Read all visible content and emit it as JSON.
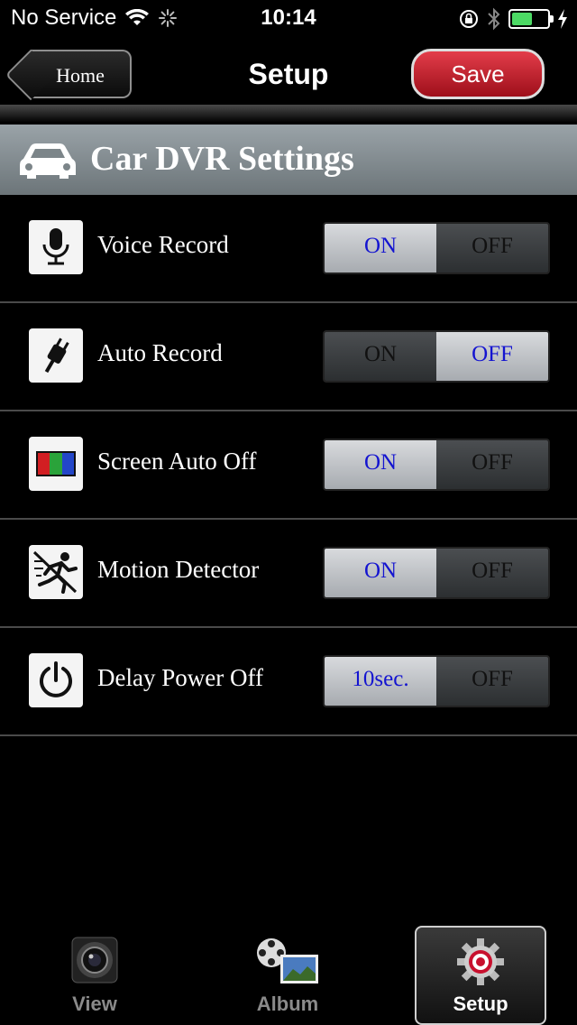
{
  "status_bar": {
    "carrier": "No Service",
    "time": "10:14"
  },
  "nav": {
    "back_label": "Home",
    "title": "Setup",
    "save_label": "Save"
  },
  "section": {
    "title": "Car DVR Settings",
    "icon": "car-icon"
  },
  "settings": [
    {
      "label": "Voice Record",
      "icon": "microphone-icon",
      "on_label": "ON",
      "off_label": "OFF",
      "selected": "on"
    },
    {
      "label": "Auto Record",
      "icon": "plug-icon",
      "on_label": "ON",
      "off_label": "OFF",
      "selected": "off"
    },
    {
      "label": "Screen Auto Off",
      "icon": "color-bars-icon",
      "on_label": "ON",
      "off_label": "OFF",
      "selected": "on"
    },
    {
      "label": "Motion Detector",
      "icon": "running-person-icon",
      "on_label": "ON",
      "off_label": "OFF",
      "selected": "on"
    },
    {
      "label": "Delay Power Off",
      "icon": "power-icon",
      "on_label": "10sec.",
      "off_label": "OFF",
      "selected": "on"
    }
  ],
  "tabs": [
    {
      "label": "View",
      "icon": "camera-lens-icon",
      "active": false
    },
    {
      "label": "Album",
      "icon": "film-photo-icon",
      "active": false
    },
    {
      "label": "Setup",
      "icon": "gear-target-icon",
      "active": true
    }
  ],
  "colors": {
    "selected_text": "#1414d0",
    "save_button": "#c81d2a",
    "section_header": "#8a9398"
  }
}
